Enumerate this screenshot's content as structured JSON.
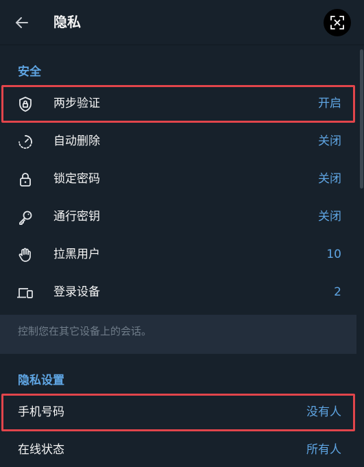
{
  "header": {
    "title": "隐私",
    "back_icon": "arrow-left-icon",
    "close_icon": "close-icon"
  },
  "security": {
    "title": "安全",
    "items": [
      {
        "label": "两步验证",
        "value": "开启",
        "icon": "lock-shield-icon"
      },
      {
        "label": "自动删除",
        "value": "关闭",
        "icon": "timer-icon"
      },
      {
        "label": "锁定密码",
        "value": "关闭",
        "icon": "lock-icon"
      },
      {
        "label": "通行密钥",
        "value": "关闭",
        "icon": "key-icon"
      },
      {
        "label": "拉黑用户",
        "value": "10",
        "icon": "hand-icon"
      },
      {
        "label": "登录设备",
        "value": "2",
        "icon": "devices-icon"
      }
    ],
    "hint": "控制您在其它设备上的会话。"
  },
  "privacy": {
    "title": "隐私设置",
    "items": [
      {
        "label": "手机号码",
        "value": "没有人"
      },
      {
        "label": "在线状态",
        "value": "所有人"
      }
    ]
  },
  "colors": {
    "background": "#17212b",
    "accent": "#5fa5e3",
    "highlight": "#e2454b",
    "hint_background": "#232e3c"
  }
}
